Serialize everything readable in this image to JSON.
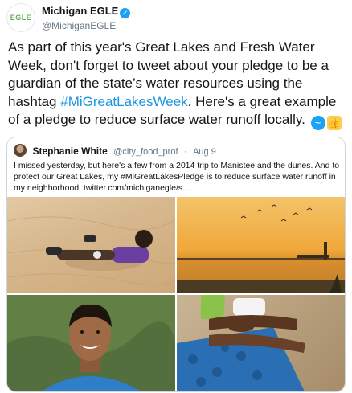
{
  "account": {
    "display_name": "Michigan EGLE",
    "handle": "@MichiganEGLE",
    "avatar_text": "EGLE",
    "verified_glyph": "✓"
  },
  "tweet": {
    "text_before": "As part of this year's Great Lakes and Fresh Water Week, don't forget to tweet about your pledge to be a guardian of the state’s water resources using the hashtag ",
    "hashtag": "#MiGreatLakesWeek",
    "text_after": ". Here's a great example of a pledge to reduce surface water runoff locally. ",
    "emojis": [
      "wave-emoji",
      "thumbs-up-emoji"
    ]
  },
  "quoted_tweet": {
    "display_name": "Stephanie White",
    "handle": "@city_food_prof",
    "separator": "·",
    "date": "Aug 9",
    "text": "I missed yesterday, but here's a few from a 2014 trip to Manistee and the dunes. And to protect our Great Lakes, my #MiGreatLakesPledge is to reduce surface water runoff in my neighborhood.  twitter.com/michiganegle/s…",
    "photos": [
      "boy-lying-on-sand-dune",
      "sunset-over-lake-with-lighthouse",
      "smiling-boy-portrait",
      "legs-on-beach-towel"
    ]
  },
  "colors": {
    "link": "#1b95e0",
    "verified": "#1da1f2",
    "border": "#ccd6dd",
    "muted": "#657786"
  }
}
